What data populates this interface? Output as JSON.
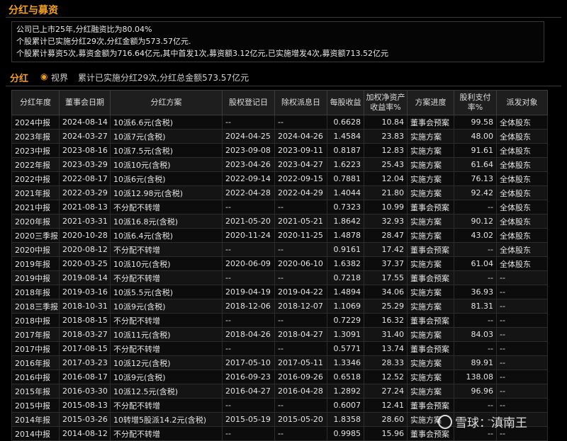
{
  "section": {
    "title": "分红与募资",
    "summary": [
      "公司已上市25年,分红融资比为80.04%",
      "个股累计已实施分红29次,分红金额为573.57亿元.",
      "个股累计募资5次,募资金额为716.64亿元,其中首发1次,募资额3.12亿元,已实施增发4次,募资额713.52亿元"
    ]
  },
  "dividend": {
    "title": "分红",
    "view_label": "视界",
    "total_text": "累计已实施分红29次,分红总金额573.57亿元"
  },
  "table": {
    "headers": [
      "分红年度",
      "董事会日期",
      "分红方案",
      "股权登记日",
      "除权派息日",
      "每股收益",
      "加权净资产收益率%",
      "方案进度",
      "股利支付率%",
      "派发对象"
    ],
    "rows": [
      [
        "2024中报",
        "2024-08-14",
        "10派6.6元(含税)",
        "--",
        "--",
        "0.6628",
        "10.84",
        "董事会预案",
        "99.58",
        "全体股东"
      ],
      [
        "2023年报",
        "2024-03-27",
        "10派7元(含税)",
        "2024-04-25",
        "2024-04-26",
        "1.4584",
        "23.83",
        "实施方案",
        "48.00",
        "全体股东"
      ],
      [
        "2023中报",
        "2023-08-16",
        "10派7.5元(含税)",
        "2023-09-08",
        "2023-09-11",
        "0.8187",
        "12.83",
        "实施方案",
        "91.61",
        "全体股东"
      ],
      [
        "2022年报",
        "2023-03-29",
        "10派10元(含税)",
        "2023-04-26",
        "2023-04-27",
        "1.6223",
        "25.43",
        "实施方案",
        "61.64",
        "全体股东"
      ],
      [
        "2022中报",
        "2022-08-17",
        "10派6元(含税)",
        "2022-09-14",
        "2022-09-15",
        "0.7881",
        "12.04",
        "实施方案",
        "76.13",
        "全体股东"
      ],
      [
        "2021年报",
        "2022-03-29",
        "10派12.98元(含税)",
        "2022-04-28",
        "2022-04-29",
        "1.4044",
        "21.80",
        "实施方案",
        "92.42",
        "全体股东"
      ],
      [
        "2021中报",
        "2021-08-13",
        "不分配不转增",
        "--",
        "--",
        "0.7323",
        "10.99",
        "董事会预案",
        "--",
        "全体股东"
      ],
      [
        "2020年报",
        "2021-03-31",
        "10派16.8元(含税)",
        "2021-05-20",
        "2021-05-21",
        "1.8642",
        "32.93",
        "实施方案",
        "90.12",
        "全体股东"
      ],
      [
        "2020三季报",
        "2020-10-28",
        "10派6.4元(含税)",
        "2020-11-24",
        "2020-11-25",
        "1.4878",
        "28.47",
        "实施方案",
        "43.02",
        "全体股东"
      ],
      [
        "2020中报",
        "2020-08-12",
        "不分配不转增",
        "--",
        "--",
        "0.9161",
        "17.42",
        "董事会预案",
        "--",
        "全体股东"
      ],
      [
        "2019年报",
        "2020-03-25",
        "10派10元(含税)",
        "2020-06-09",
        "2020-06-10",
        "1.6382",
        "37.37",
        "实施方案",
        "61.04",
        "全体股东"
      ],
      [
        "2019中报",
        "2019-08-14",
        "不分配不转增",
        "--",
        "--",
        "0.7218",
        "17.55",
        "董事会预案",
        "--",
        "--"
      ],
      [
        "2018年报",
        "2019-03-16",
        "10派5.5元(含税)",
        "2019-04-19",
        "2019-04-22",
        "1.4894",
        "34.06",
        "实施方案",
        "36.93",
        "--"
      ],
      [
        "2018三季报",
        "2018-10-31",
        "10派9元(含税)",
        "2018-12-06",
        "2018-12-07",
        "1.1069",
        "25.29",
        "实施方案",
        "81.31",
        "--"
      ],
      [
        "2018中报",
        "2018-08-15",
        "不分配不转增",
        "--",
        "--",
        "0.7229",
        "16.32",
        "董事会预案",
        "--",
        "--"
      ],
      [
        "2017年报",
        "2018-03-27",
        "10派11元(含税)",
        "2018-04-26",
        "2018-04-27",
        "1.3091",
        "31.40",
        "实施方案",
        "84.03",
        "--"
      ],
      [
        "2017中报",
        "2017-08-15",
        "不分配不转增",
        "--",
        "--",
        "0.5771",
        "13.74",
        "董事会预案",
        "--",
        "--"
      ],
      [
        "2016年报",
        "2017-03-23",
        "10派12元(含税)",
        "2017-05-10",
        "2017-05-11",
        "1.3346",
        "28.33",
        "实施方案",
        "89.91",
        "--"
      ],
      [
        "2016中报",
        "2016-08-17",
        "10派9元(含税)",
        "2016-09-23",
        "2016-09-26",
        "0.6518",
        "12.52",
        "实施方案",
        "138.08",
        "--"
      ],
      [
        "2015年报",
        "2016-03-30",
        "10派12.5元(含税)",
        "2016-04-27",
        "2016-04-28",
        "1.2892",
        "27.24",
        "实施方案",
        "96.96",
        "--"
      ],
      [
        "2015中报",
        "2015-08-13",
        "不分配不转增",
        "--",
        "--",
        "0.6007",
        "12.41",
        "董事会预案",
        "--",
        "--"
      ],
      [
        "2014年报",
        "2015-03-26",
        "10转增5股派14.2元(含税)",
        "2015-05-19",
        "2015-05-20",
        "1.8358",
        "28.60",
        "实施方案",
        "--",
        "--"
      ],
      [
        "2014中报",
        "2014-08-12",
        "不分配不转增",
        "--",
        "--",
        "0.9985",
        "15.96",
        "董事会预案",
        "--",
        "--"
      ]
    ]
  },
  "watermark": {
    "text": "雪球：滇南王"
  },
  "colors": {
    "accent": "#f0a020",
    "background": "#000000",
    "header_bg": "#1e1e1e"
  },
  "icons": {
    "view": "eye-icon",
    "watermark": "snowball-logo-icon"
  }
}
